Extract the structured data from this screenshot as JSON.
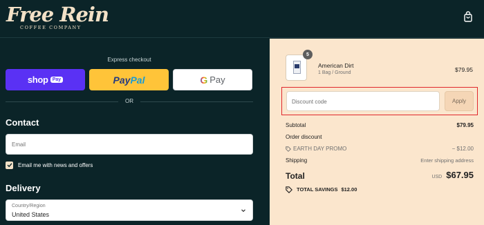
{
  "brand": {
    "logo_main": "Free Rein",
    "logo_sub": "COFFEE COMPANY"
  },
  "header": {
    "cart_icon": "shopping-bag-icon"
  },
  "express": {
    "title": "Express checkout",
    "shop_label": "shop",
    "shop_pay_label": "Pay",
    "paypal_label_1": "Pay",
    "paypal_label_2": "Pal",
    "gpay_g": "G",
    "gpay_label": "Pay",
    "or_label": "OR"
  },
  "contact": {
    "title": "Contact",
    "email_placeholder": "Email",
    "newsletter_label": "Email me with news and offers",
    "newsletter_checked": true
  },
  "delivery": {
    "title": "Delivery",
    "country_label": "Country/Region",
    "country_value": "United States"
  },
  "order": {
    "item": {
      "name": "American Dirt",
      "variant": "1 Bag / Ground",
      "price": "$79.95",
      "quantity": "5"
    },
    "discount_placeholder": "Discount code",
    "apply_label": "Apply",
    "subtotal_label": "Subtotal",
    "subtotal_value": "$79.95",
    "order_discount_label": "Order discount",
    "promo_label": "EARTH DAY PROMO",
    "promo_value": "− $12.00",
    "shipping_label": "Shipping",
    "shipping_value": "Enter shipping address",
    "total_label": "Total",
    "currency": "USD",
    "total_value": "$67.95",
    "savings_label": "TOTAL SAVINGS",
    "savings_value": "$12.00"
  },
  "colors": {
    "header_bg": "#0b2428",
    "summary_bg": "#fbe6cd",
    "shop_pay": "#5a31f4",
    "paypal": "#ffc439",
    "highlight": "#e0262b"
  }
}
